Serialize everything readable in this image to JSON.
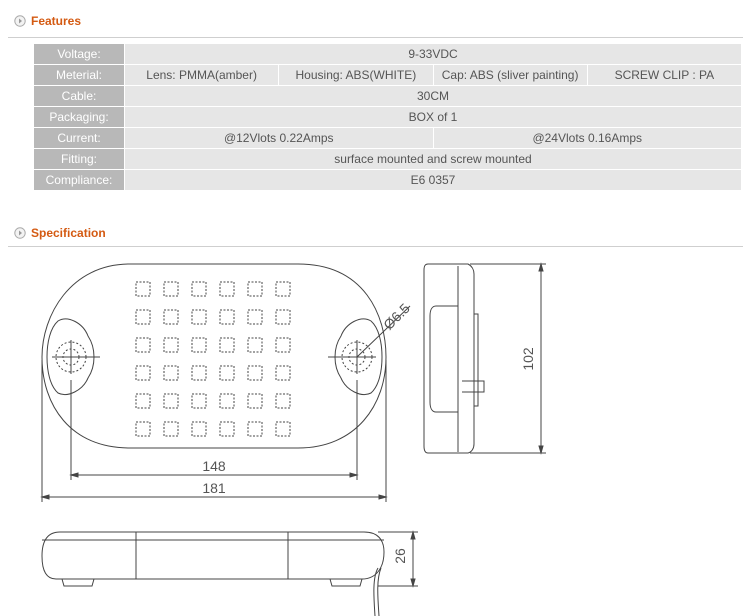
{
  "features": {
    "title": "Features",
    "rows": {
      "voltage": {
        "label": "Voltage:",
        "value": "9-33VDC"
      },
      "material": {
        "label": "Meterial:",
        "lens": "Lens:  PMMA(amber)",
        "housing": "Housing:  ABS(WHITE)",
        "cap": "Cap:  ABS (sliver painting)",
        "clip": "SCREW CLIP : PA"
      },
      "cable": {
        "label": "Cable:",
        "value": "30CM"
      },
      "packaging": {
        "label": "Packaging:",
        "value": "BOX of 1"
      },
      "current": {
        "label": "Current:",
        "v12": "@12Vlots  0.22Amps",
        "v24": "@24Vlots  0.16Amps"
      },
      "fitting": {
        "label": "Fitting:",
        "value": "surface mounted and screw mounted"
      },
      "compliance": {
        "label": "Compliance:",
        "value": "E6 0357"
      }
    }
  },
  "specification": {
    "title": "Specification",
    "dimensions": {
      "hole_diameter": "Ø6.5",
      "inner_width": "148",
      "outer_width": "181",
      "height": "102",
      "depth": "26"
    }
  },
  "colors": {
    "heading": "#d45a12",
    "label_bg": "#b8b8b8",
    "value_bg": "#e6e6e6",
    "text": "#555555"
  }
}
